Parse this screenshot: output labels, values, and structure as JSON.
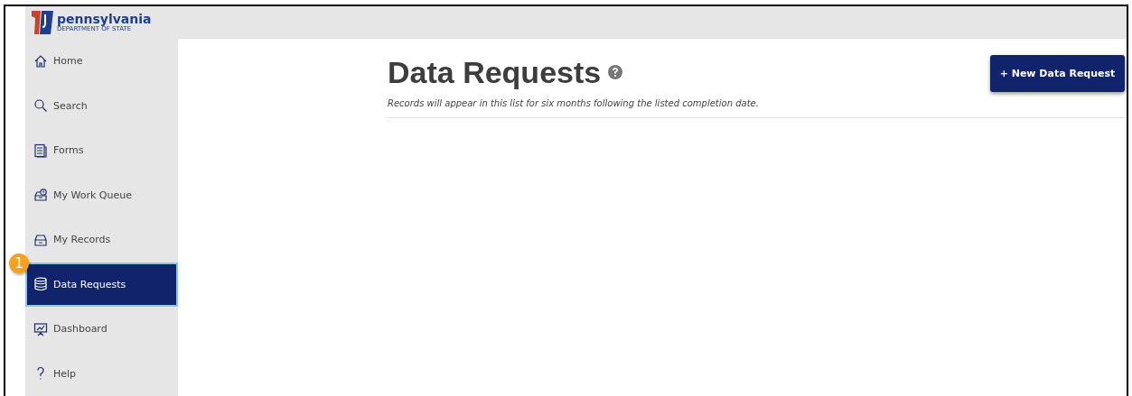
{
  "logo": {
    "name": "pennsylvania",
    "subtitle": "DEPARTMENT OF STATE"
  },
  "sidebar": {
    "items": [
      {
        "label": "Home",
        "selected": false
      },
      {
        "label": "Search",
        "selected": false
      },
      {
        "label": "Forms",
        "selected": false
      },
      {
        "label": "My Work Queue",
        "selected": false
      },
      {
        "label": "My Records",
        "selected": false
      },
      {
        "label": "Data Requests",
        "selected": true,
        "callout": "1"
      },
      {
        "label": "Dashboard",
        "selected": false
      },
      {
        "label": "Help",
        "selected": false
      }
    ]
  },
  "page": {
    "title": "Data Requests",
    "subtitle": "Records will appear in this list for six months following the listed completion date.",
    "button": "+ New Data Request"
  }
}
